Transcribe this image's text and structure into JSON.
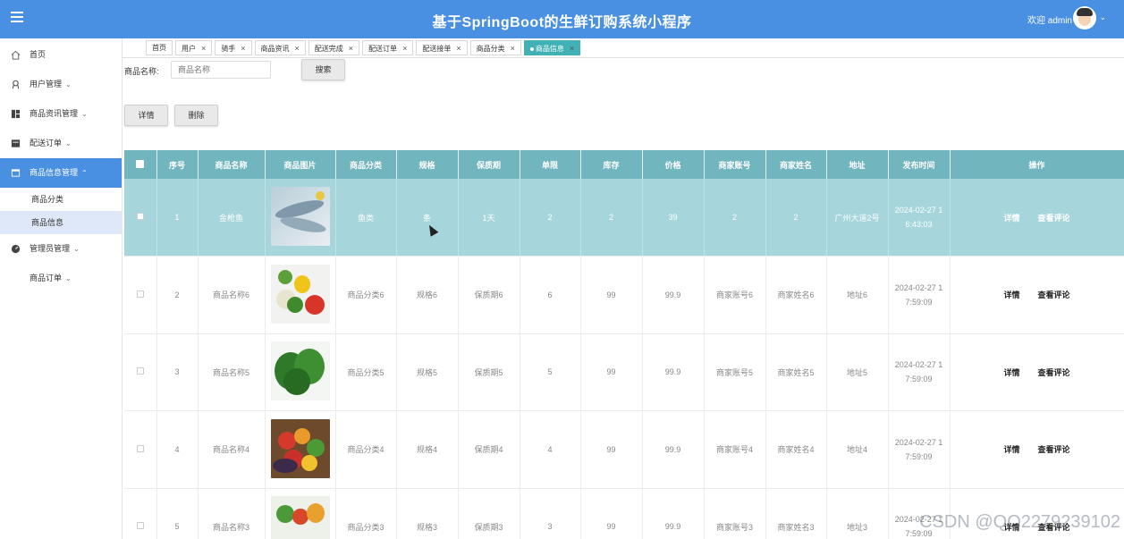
{
  "header": {
    "title": "基于SpringBoot的生鲜订购系统小程序",
    "welcome": "欢迎 admin",
    "user_caret": "⌄"
  },
  "sidebar": {
    "items": [
      {
        "label": "首页",
        "icon": "home-icon",
        "caret": "⌄"
      },
      {
        "label": "用户管理",
        "icon": "user-icon",
        "caret": "⌄"
      },
      {
        "label": "商品资讯管理",
        "icon": "grid-icon",
        "caret": "⌄"
      },
      {
        "label": "配送订单",
        "icon": "doc-icon",
        "caret": "⌄"
      },
      {
        "label": "商品信息管理",
        "icon": "window-icon",
        "caret": "⌃"
      }
    ],
    "subitems": [
      {
        "label": "商品分类"
      },
      {
        "label": "商品信息"
      }
    ],
    "items2": [
      {
        "label": "管理员管理",
        "icon": "gauge-icon",
        "caret": "⌄"
      },
      {
        "label": "商品订单",
        "caret": "⌄"
      }
    ]
  },
  "tabs": [
    {
      "label": "首页",
      "close": ""
    },
    {
      "label": "用户",
      "close": "×"
    },
    {
      "label": "骑手",
      "close": "×"
    },
    {
      "label": "商品资讯",
      "close": "×"
    },
    {
      "label": "配送完成",
      "close": "×"
    },
    {
      "label": "配送订单",
      "close": "×"
    },
    {
      "label": "配送接单",
      "close": "×"
    },
    {
      "label": "商品分类",
      "close": "×"
    },
    {
      "label": "商品信息",
      "close": "×"
    }
  ],
  "search": {
    "label": "商品名称:",
    "placeholder": "商品名称",
    "button": "搜索"
  },
  "actions": {
    "detail": "详情",
    "delete": "删除"
  },
  "table": {
    "columns": [
      "序号",
      "商品名称",
      "商品图片",
      "商品分类",
      "规格",
      "保质期",
      "单限",
      "库存",
      "价格",
      "商家账号",
      "商家姓名",
      "地址",
      "发布时间",
      "操作"
    ],
    "rows": [
      {
        "no": "1",
        "name": "金枪鱼",
        "category": "鱼类",
        "spec": "条",
        "shelf": "1天",
        "limit": "2",
        "stock": "2",
        "price": "39",
        "account": "2",
        "merchant": "2",
        "address": "广州大道2号",
        "date1": "2024-02-27 1",
        "date2": "6:43:03",
        "op1": "详情",
        "op2": "查看评论"
      },
      {
        "no": "2",
        "name": "商品名称6",
        "category": "商品分类6",
        "spec": "规格6",
        "shelf": "保质期6",
        "limit": "6",
        "stock": "99",
        "price": "99.9",
        "account": "商家账号6",
        "merchant": "商家姓名6",
        "address": "地址6",
        "date1": "2024-02-27 1",
        "date2": "7:59:09",
        "op1": "详情",
        "op2": "查看评论"
      },
      {
        "no": "3",
        "name": "商品名称5",
        "category": "商品分类5",
        "spec": "规格5",
        "shelf": "保质期5",
        "limit": "5",
        "stock": "99",
        "price": "99.9",
        "account": "商家账号5",
        "merchant": "商家姓名5",
        "address": "地址5",
        "date1": "2024-02-27 1",
        "date2": "7:59:09",
        "op1": "详情",
        "op2": "查看评论"
      },
      {
        "no": "4",
        "name": "商品名称4",
        "category": "商品分类4",
        "spec": "规格4",
        "shelf": "保质期4",
        "limit": "4",
        "stock": "99",
        "price": "99.9",
        "account": "商家账号4",
        "merchant": "商家姓名4",
        "address": "地址4",
        "date1": "2024-02-27 1",
        "date2": "7:59:09",
        "op1": "详情",
        "op2": "查看评论"
      },
      {
        "no": "5",
        "name": "商品名称3",
        "category": "商品分类3",
        "spec": "规格3",
        "shelf": "保质期3",
        "limit": "3",
        "stock": "99",
        "price": "99.9",
        "account": "商家账号3",
        "merchant": "商家姓名3",
        "address": "地址3",
        "date1": "2024-02-27 1",
        "date2": "7:59:09",
        "op1": "详情",
        "op2": "查看评论"
      }
    ]
  },
  "watermark": "CSDN @QQ2279239102",
  "colors": {
    "header": "#4a90e2",
    "table_header": "#71b5bf",
    "active_tab": "#42b1b5",
    "selected_row": "#a6d6dc"
  }
}
